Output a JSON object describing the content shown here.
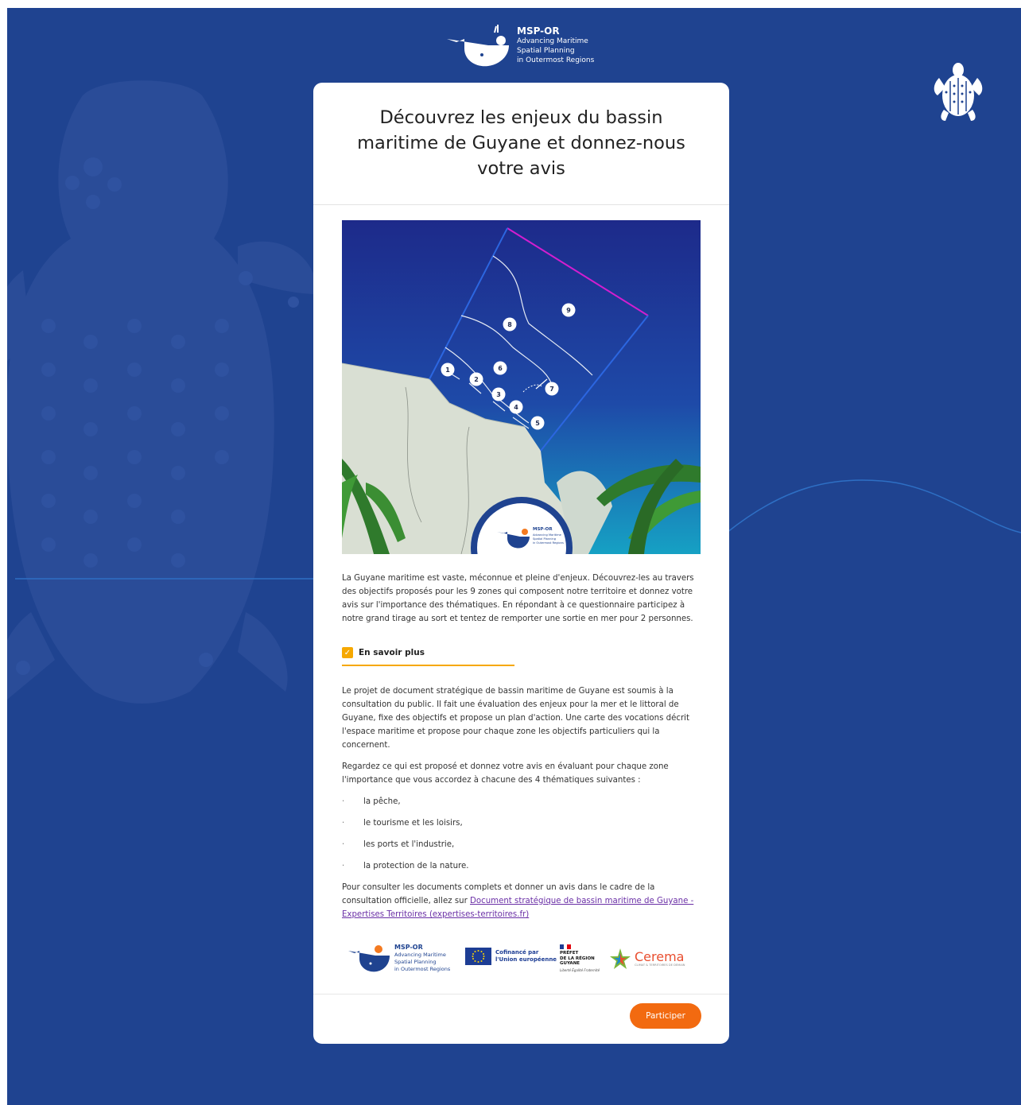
{
  "brand": {
    "name": "MSP-OR",
    "tagline_1": "Advancing Maritime",
    "tagline_2": "Spatial Planning",
    "tagline_3": "in Outermost Regions"
  },
  "card": {
    "title": "Découvrez les enjeux du bassin maritime de Guyane et donnez-nous votre avis",
    "intro": "La Guyane maritime est vaste, méconnue et pleine d'enjeux. Découvrez-les au travers des objectifs proposés pour les 9 zones qui composent notre territoire et donnez votre avis sur l'importance des thématiques. En répondant à ce questionnaire participez à notre grand tirage au sort et tentez de remporter une sortie en mer pour 2 personnes.",
    "checkbox_label": "En savoir plus",
    "details_p1": "Le projet de document stratégique de bassin maritime de Guyane est soumis à la consultation du public. Il fait une évaluation des enjeux pour la mer et le littoral de Guyane, fixe des objectifs et propose un plan d'action. Une carte des vocations décrit l'espace maritime et propose pour chaque zone les objectifs particuliers qui la concernent.",
    "details_p2": "Regardez ce qui est proposé et donnez votre avis en évaluant pour chaque zone l'importance que vous accordez à chacune des 4 thématiques suivantes :",
    "themes": [
      "la pêche,",
      "le tourisme et les loisirs,",
      "les ports et l'industrie,",
      "la protection de la nature."
    ],
    "details_p3_prefix": "Pour consulter les documents complets et donner un avis dans le cadre de la consultation officielle, allez sur ",
    "link_text": "Document stratégique de bassin maritime de Guyane - Expertises Territoires (expertises-territoires.fr)",
    "participate_label": "Participer"
  },
  "map": {
    "zones": [
      "1",
      "2",
      "3",
      "4",
      "5",
      "6",
      "7",
      "8",
      "9"
    ]
  },
  "partners": {
    "eu_line1": "Cofinancé par",
    "eu_line2": "l'Union européenne",
    "prefet_line1": "PRÉFET",
    "prefet_line2": "DE LA RÉGION",
    "prefet_line3": "GUYANE",
    "prefet_motto": "Liberté Égalité Fraternité",
    "cerema": "Cerema",
    "cerema_tag": "CLIMAT & TERRITOIRES DE DEMAIN"
  },
  "colors": {
    "background": "#1f4390",
    "accent_orange": "#f26a10",
    "checkbox_yellow": "#f6a800"
  }
}
